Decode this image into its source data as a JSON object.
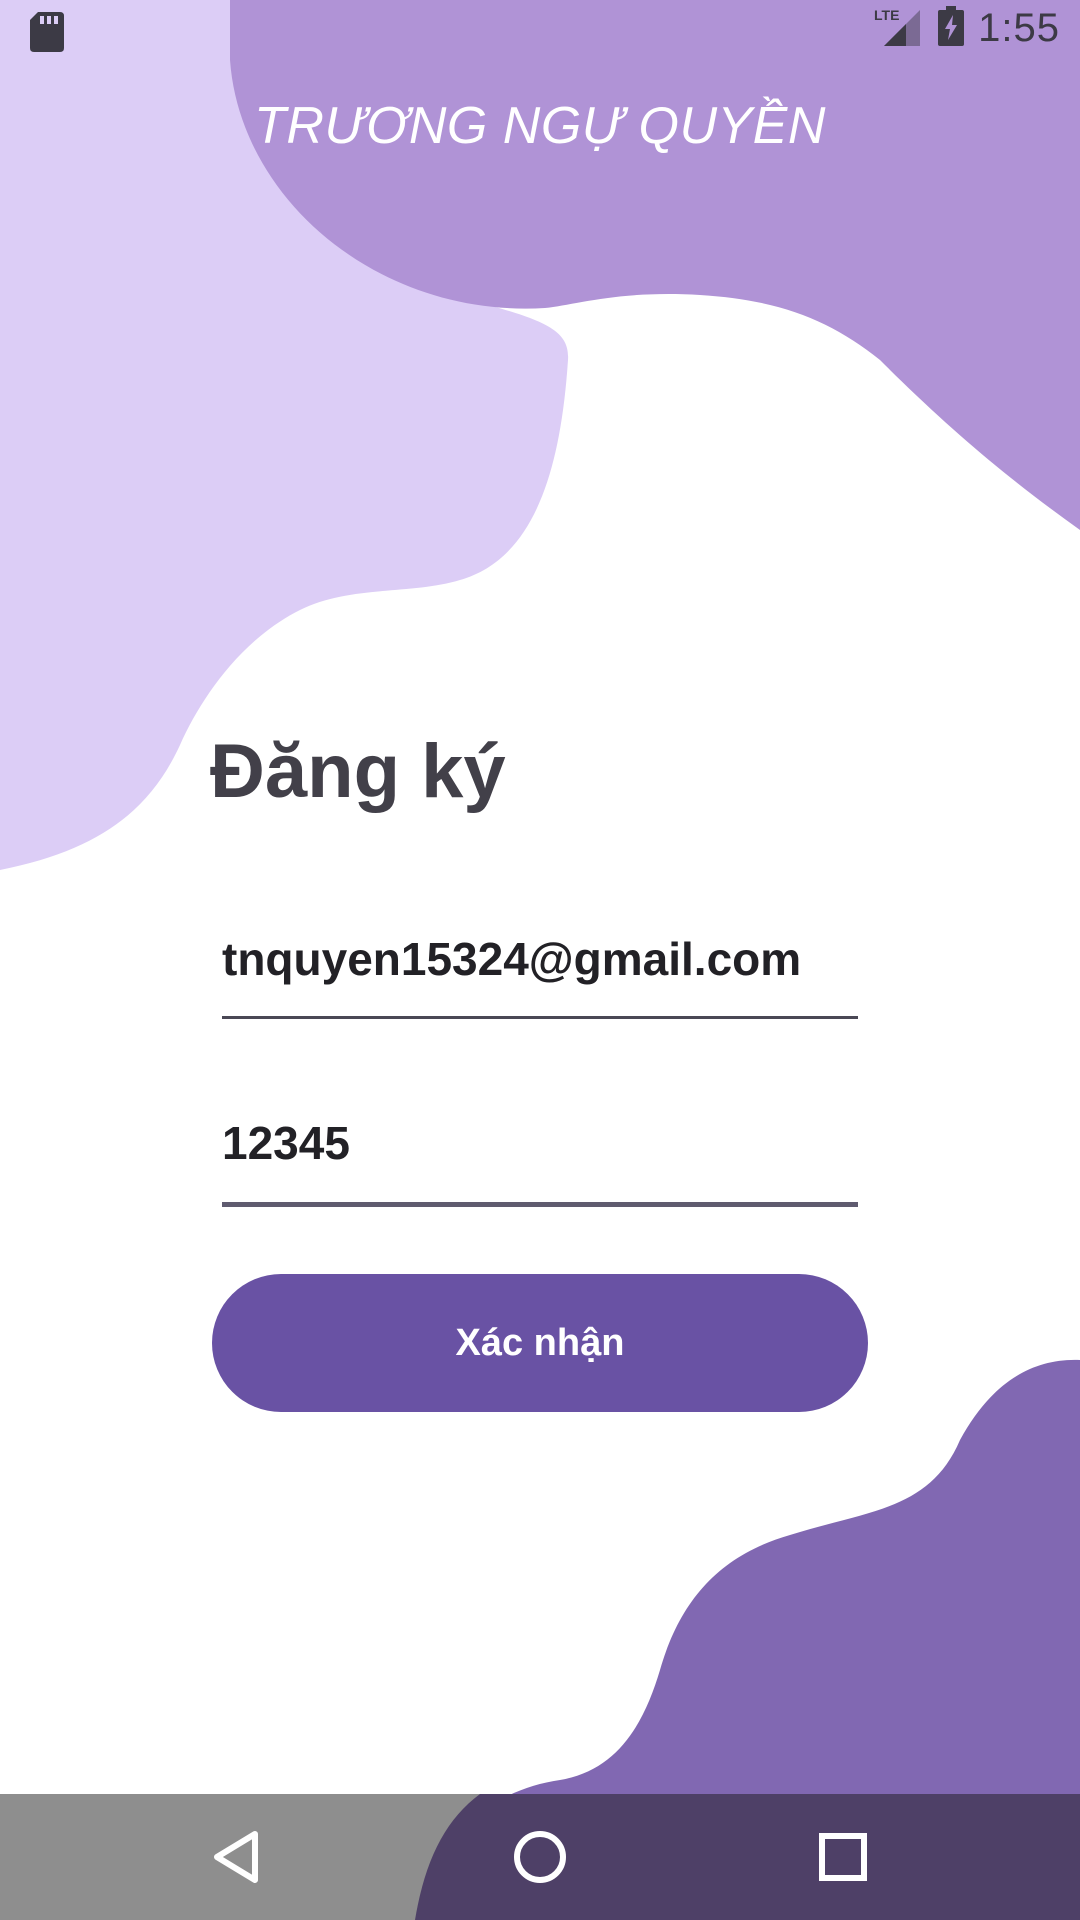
{
  "status_bar": {
    "time": "1:55",
    "network": "LTE",
    "icons": [
      "sd-card-icon",
      "lte-signal-icon",
      "battery-charging-icon"
    ]
  },
  "app": {
    "title": "TRƯƠNG NGỰ QUYỀN"
  },
  "form": {
    "heading": "Đăng ký",
    "email_value": "tnquyen15324@gmail.com",
    "password_value": "12345",
    "submit_label": "Xác nhận"
  },
  "nav_bar": {
    "icons": [
      "back-icon",
      "home-icon",
      "recents-icon"
    ]
  },
  "colors": {
    "blob_light": "#dccdf6",
    "blob_mid": "#b093d6",
    "blob_dark": "#8168b2",
    "button": "#6952a4",
    "nav_bar": "#8e8e8e",
    "heading_text": "#424049"
  }
}
